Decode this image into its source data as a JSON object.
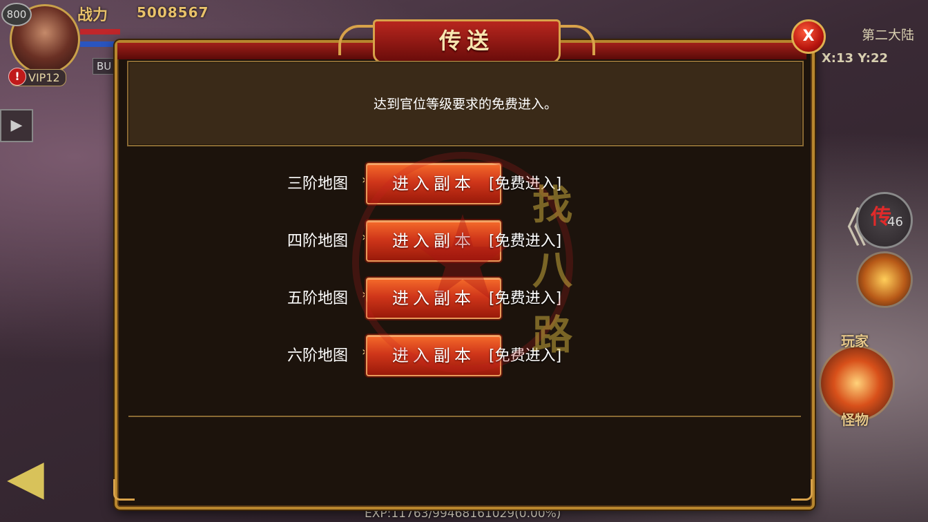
{
  "hud": {
    "level": "800",
    "combat_power_label": "战力",
    "combat_power_value": "5008567",
    "bu_tag": "BU",
    "vip": "VIP12",
    "alert_glyph": "!",
    "play_glyph": "▶",
    "map_name": "第二大陆",
    "coords": "X:13 Y:22",
    "teleport_skill_glyph": "传",
    "teleport_skill_count": "46",
    "back_glyph": "《",
    "mode_player": "玩家",
    "mode_monster": "怪物",
    "left_glyph": "◀",
    "exp": "EXP:11763/99468161029(0.00%)"
  },
  "dialog": {
    "title": "传送",
    "close_label": "X",
    "notice": "达到官位等级要求的免费进入。",
    "rows": [
      {
        "map": "三阶地图",
        "button": "进入副本",
        "tag": "[免费进入]"
      },
      {
        "map": "四阶地图",
        "button": "进入副本",
        "tag": "[免费进入]"
      },
      {
        "map": "五阶地图",
        "button": "进入副本",
        "tag": "[免费进入]"
      },
      {
        "map": "六阶地图",
        "button": "进入副本",
        "tag": "[免费进入]"
      }
    ]
  },
  "watermark": {
    "star": "★",
    "chars": "找八路"
  },
  "colors": {
    "frame_gold": "#b8862e",
    "title_red": "#b8261e",
    "button_orange": "#d0361a",
    "dialog_bg": "#1c130c"
  }
}
